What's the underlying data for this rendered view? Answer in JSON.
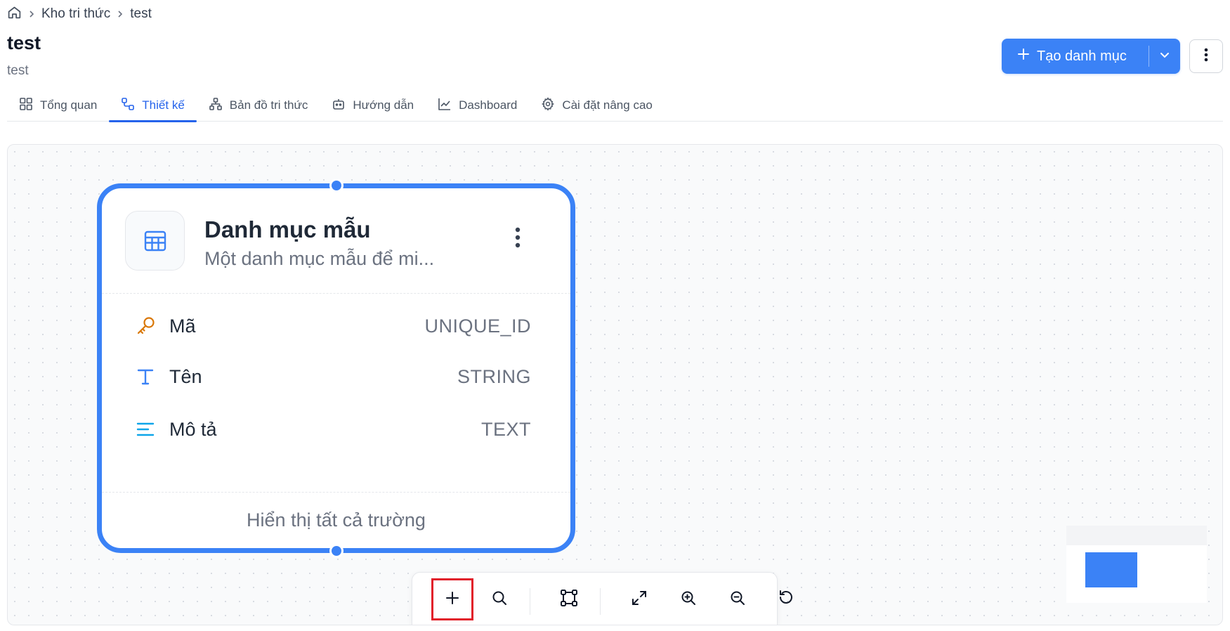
{
  "breadcrumb": {
    "home_icon": "home-icon",
    "items": [
      "Kho tri thức",
      "test"
    ]
  },
  "header": {
    "title": "test",
    "subtitle": "test",
    "create_button_label": "Tạo danh mục"
  },
  "tabs": [
    {
      "label": "Tổng quan",
      "icon": "grid-icon",
      "active": false
    },
    {
      "label": "Thiết kế",
      "icon": "design-icon",
      "active": true
    },
    {
      "label": "Bản đồ tri thức",
      "icon": "sitemap-icon",
      "active": false
    },
    {
      "label": "Hướng dẫn",
      "icon": "robot-icon",
      "active": false
    },
    {
      "label": "Dashboard",
      "icon": "line-chart-icon",
      "active": false
    },
    {
      "label": "Cài đặt nâng cao",
      "icon": "gear-icon",
      "active": false
    }
  ],
  "node": {
    "title": "Danh mục mẫu",
    "description": "Một danh mục mẫu để mi...",
    "fields": [
      {
        "name": "Mã",
        "type": "UNIQUE_ID",
        "icon": "key-icon"
      },
      {
        "name": "Tên",
        "type": "STRING",
        "icon": "text-type-icon"
      },
      {
        "name": "Mô tả",
        "type": "TEXT",
        "icon": "align-left-icon"
      }
    ],
    "footer_label": "Hiển thị tất cả trường"
  },
  "toolbar": {
    "buttons": [
      "add-icon",
      "search-icon",
      "select-frame-icon",
      "expand-icon",
      "zoom-in-icon",
      "zoom-out-icon",
      "reset-icon"
    ],
    "highlighted": "add-icon"
  },
  "colors": {
    "accent": "#3b82f6",
    "active_tab": "#2563eb",
    "key_icon": "#d97706",
    "text_icon": "#3b82f6",
    "desc_icon": "#0ea5e9",
    "highlight_border": "#e11d2a"
  }
}
